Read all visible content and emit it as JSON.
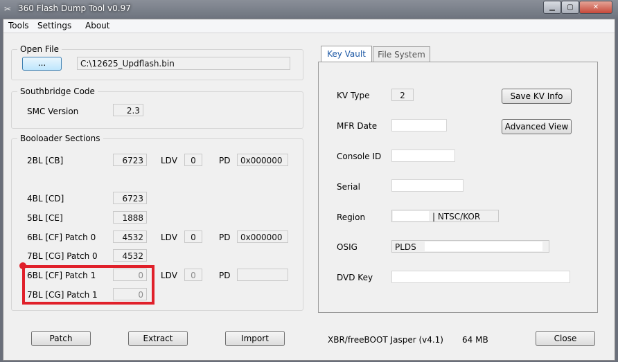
{
  "window": {
    "title": "360 Flash Dump Tool   v0.97"
  },
  "menu": [
    "Tools",
    "Settings",
    "About"
  ],
  "open_file": {
    "group_label": "Open File",
    "browse_label": "...",
    "path": "C:\\12625_Updflash.bin"
  },
  "southbridge": {
    "group_label": "Southbridge Code",
    "smc_label": "SMC Version",
    "smc_value": "2.3"
  },
  "bootloader": {
    "group_label": "Booloader Sections",
    "ldv_label": "LDV",
    "pd_label": "PD",
    "rows": [
      {
        "label": "2BL [CB]",
        "value": "6723",
        "ldv": "0",
        "pd": "0x000000"
      },
      {
        "label": "4BL [CD]",
        "value": "6723"
      },
      {
        "label": "5BL [CE]",
        "value": "1888"
      },
      {
        "label": "6BL [CF] Patch 0",
        "value": "4532",
        "ldv": "0",
        "pd": "0x000000"
      },
      {
        "label": "7BL [CG] Patch 0",
        "value": "4532"
      },
      {
        "label": "6BL [CF] Patch 1",
        "value": "0",
        "ldv": "0",
        "pd": ""
      },
      {
        "label": "7BL [CG] Patch 1",
        "value": "0"
      }
    ]
  },
  "tabs": [
    "Key Vault",
    "File System"
  ],
  "keyvault": {
    "kv_type_label": "KV Type",
    "kv_type": "2",
    "mfr_date_label": "MFR Date",
    "console_id_label": "Console ID",
    "serial_label": "Serial",
    "region_label": "Region",
    "region_value": "|   NTSC/KOR",
    "osig_label": "OSIG",
    "osig_value": "PLDS",
    "dvd_key_label": "DVD Key",
    "save_kv_label": "Save KV Info",
    "advanced_label": "Advanced View"
  },
  "bottom": {
    "patch_label": "Patch",
    "extract_label": "Extract",
    "import_label": "Import",
    "status": "XBR/freeBOOT Jasper (v4.1)",
    "size": "64 MB",
    "close_label": "Close"
  }
}
